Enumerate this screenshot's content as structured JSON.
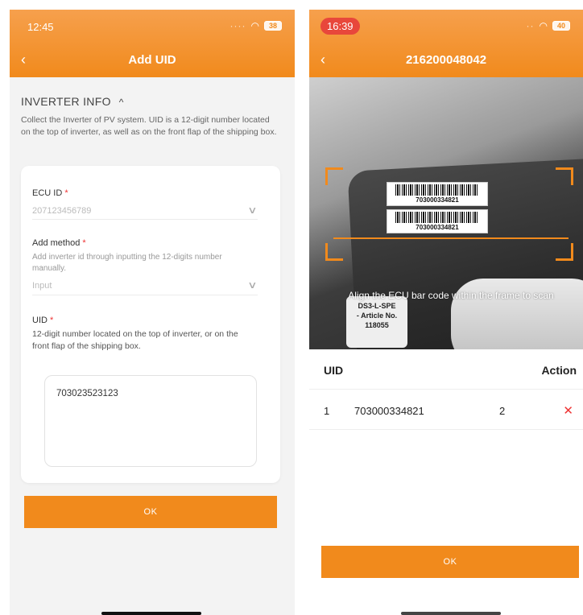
{
  "left": {
    "status": {
      "time": "12:45",
      "battery": "38"
    },
    "header": {
      "back": "‹",
      "title": "Add UID"
    },
    "section": {
      "title": "INVERTER INFO",
      "chevron": "^",
      "description": "Collect the Inverter of PV system. UID is a 12-digit number located on the top of inverter, as well as on the front flap of the shipping box."
    },
    "fields": {
      "ecu": {
        "label": "ECU ID",
        "required": "*",
        "value": "207123456789",
        "chevron": "∨"
      },
      "method": {
        "label": "Add method",
        "required": "*",
        "hint": "Add inverter id through inputting the 12-digits number manually.",
        "value": "Input",
        "chevron": "∨"
      },
      "uid": {
        "label": "UID",
        "required": "*",
        "hint": "12-digit number located on the top of inverter, or on the front flap of the shipping box.",
        "value": "703023523123"
      }
    },
    "ok_label": "OK"
  },
  "right": {
    "status": {
      "time": "16:39",
      "battery": "40"
    },
    "header": {
      "back": "‹",
      "title": "216200048042"
    },
    "camera": {
      "barcode_1": "703000334821",
      "barcode_2": "703000334821",
      "label_line_1": "DS3-L-SPE",
      "label_line_2": "- Article No.",
      "label_line_3": "118055",
      "hint": "Align the ECU bar code within the frame to scan"
    },
    "table": {
      "headers": {
        "uid": "UID",
        "action": "Action"
      },
      "rows": [
        {
          "index": "1",
          "uid": "703000334821",
          "qty": "2",
          "action": "✕"
        }
      ]
    },
    "ok_label": "OK"
  },
  "colors": {
    "accent": "#f18a1c",
    "required": "#e33333"
  }
}
